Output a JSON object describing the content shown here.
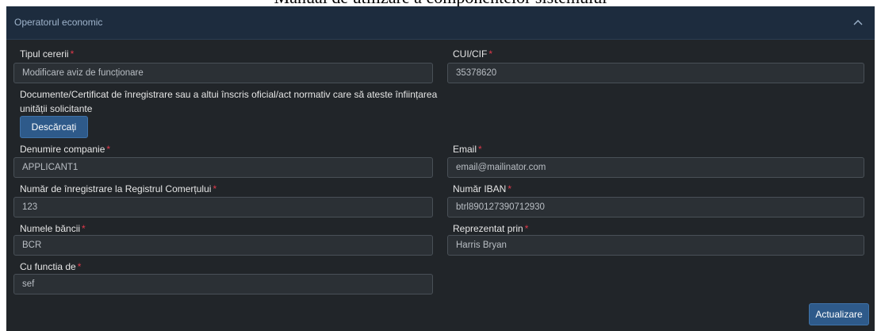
{
  "document": {
    "title": "Manual de utilizare a componentelor sistemului"
  },
  "panel": {
    "header_title": "Operatorul economic",
    "collapse_icon": "chevron-up-icon"
  },
  "form": {
    "tipul_cererii": {
      "label": "Tipul cererii",
      "value": "Modificare aviz de funcționare"
    },
    "cui_cif": {
      "label": "CUI/CIF",
      "value": "35378620"
    },
    "documente_text": "Documente/Certificat de înregistrare sau a altui înscris oficial/act normativ care să ateste înființarea unității solicitante",
    "download_label": "Descărcați",
    "denumire_companie": {
      "label": "Denumire companie",
      "value": "APPLICANT1"
    },
    "email": {
      "label": "Email",
      "value": "email@mailinator.com"
    },
    "nr_registru": {
      "label": "Număr de înregistrare la Registrul Comerțului",
      "value": "123"
    },
    "iban": {
      "label": "Număr IBAN",
      "value": "btrl890127390712930"
    },
    "banca": {
      "label": "Numele băncii",
      "value": "BCR"
    },
    "reprezentat": {
      "label": "Reprezentat prin",
      "value": "Harris Bryan"
    },
    "functia": {
      "label": "Cu functia de",
      "value": "sef"
    },
    "required_marker": "*",
    "update_label": "Actualizare"
  },
  "colors": {
    "panel_bg": "#212529",
    "header_bg": "#1d2c3e",
    "input_bg": "#2b3035",
    "primary_button": "#2e5a8a",
    "required": "#e0394a"
  }
}
